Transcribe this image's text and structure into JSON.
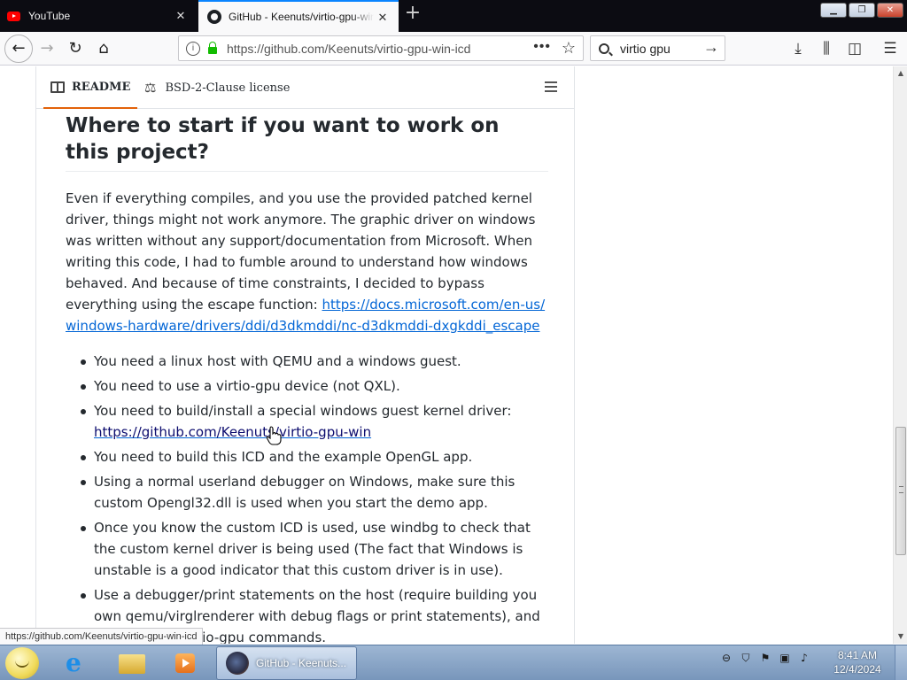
{
  "browser": {
    "tabs": [
      {
        "title": "YouTube",
        "icon": "youtube-icon",
        "active": false
      },
      {
        "title": "GitHub - Keenuts/virtio-gpu-win-icd",
        "icon": "github-icon",
        "active": true
      }
    ],
    "new_tab_label": "+",
    "url": "https://github.com/Keenuts/virtio-gpu-win-icd",
    "search_value": "virtio gpu",
    "url_actions": "•••",
    "status_url": "https://github.com/Keenuts/virtio-gpu-win-icd"
  },
  "readme": {
    "tabs": [
      {
        "label": "README"
      },
      {
        "label": "BSD-2-Clause license"
      }
    ],
    "heading": "Where to start if you want to work on this project?",
    "intro": "Even if everything compiles, and you use the provided patched kernel driver, things might not work anymore. The graphic driver on windows was written without any support/documentation from Microsoft. When writing this code, I had to fumble around to understand how windows behaved. And because of time constraints, I decided to bypass everything using the escape function:",
    "intro_link": "https://docs.microsoft.com/en-us/windows-hardware/drivers/ddi/d3dkmddi/nc-d3dkmddi-dxgkddi_escape",
    "bullets": [
      {
        "text": "You need a linux host with QEMU and a windows guest."
      },
      {
        "text": "You need to use a virtio-gpu device (not QXL)."
      },
      {
        "text": "You need to build/install a special windows guest kernel driver:",
        "link": "https://github.com/Keenuts/virtio-gpu-win"
      },
      {
        "text": "You need to build this ICD and the example OpenGL app."
      },
      {
        "text": "Using a normal userland debugger on Windows, make sure this custom Opengl32.dll is used when you start the demo app."
      },
      {
        "text": "Once you know the custom ICD is used, use windbg to check that the custom kernel driver is being used (The fact that Windows is unstable is a good indicator that this custom driver is in use)."
      },
      {
        "text": "Use a debugger/print statements on the host (require building you own qemu/virglrenderer with debug flags or print statements), and check the ... virtio-gpu commands."
      }
    ]
  },
  "taskbar": {
    "task_label": "GitHub - Keenuts...",
    "time": "8:41 AM",
    "date": "12/4/2024"
  },
  "colors": {
    "link": "#0366d6",
    "active_tab_underline": "#e36209",
    "tab_highlight": "#0a84ff",
    "lock_green": "#12bc00"
  }
}
